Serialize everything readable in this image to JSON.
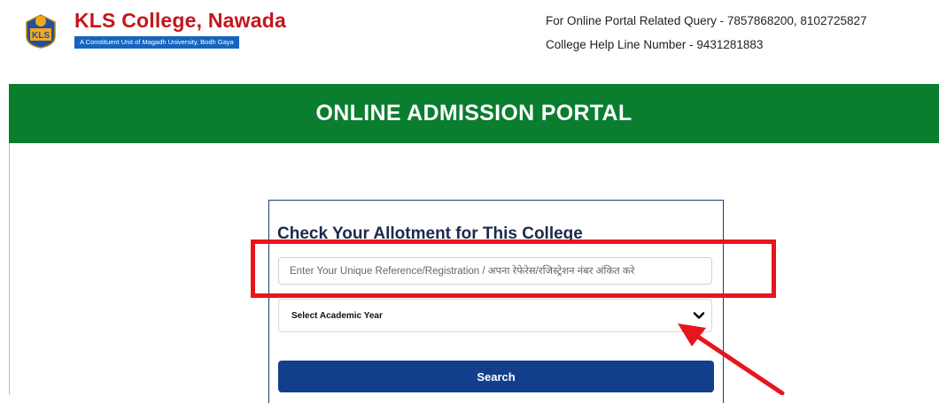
{
  "header": {
    "college_name": "KLS College, Nawada",
    "college_subtitle": "A Constituent Unit of Magadh University, Bodh Gaya",
    "logo_icon": "college-emblem-icon",
    "query_line": "For Online Portal Related Query - 7857868200, 8102725827",
    "help_line": "College Help Line Number - 9431281883"
  },
  "banner": {
    "title": "ONLINE ADMISSION PORTAL"
  },
  "form": {
    "title": "Check Your Allotment for This College",
    "reference_placeholder": "Enter Your Unique Reference/Registration / अपना रेफेरेस/रजिस्ट्रेशन नंबर अंकित करे",
    "reference_value": "",
    "academic_year_selected": "Select Academic Year",
    "search_label": "Search"
  },
  "annotations": {
    "highlight_color": "#e8151d",
    "arrow_icon": "red-arrow-icon"
  },
  "colors": {
    "banner": "#0a7d2f",
    "button": "#123f8c",
    "college_name": "#c4161c",
    "subtitle_bg": "#1565c0"
  }
}
